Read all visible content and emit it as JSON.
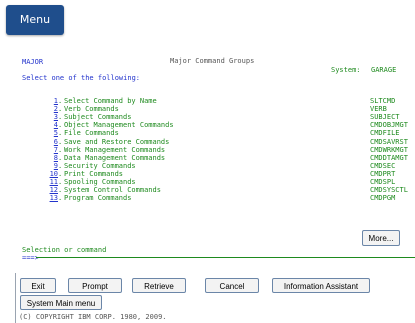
{
  "menu_tab": {
    "label": "Menu"
  },
  "header": {
    "menu_id": "MAJOR",
    "title": "Major Command Groups",
    "system_label": "System:",
    "system_name": "GARAGE"
  },
  "prompt": "Select one of the following:",
  "menu_items": [
    {
      "number": "1",
      "label": "Select Command by Name",
      "command": "SLTCMD"
    },
    {
      "number": "2",
      "label": "Verb Commands",
      "command": "VERB"
    },
    {
      "number": "3",
      "label": "Subject Commands",
      "command": "SUBJECT"
    },
    {
      "number": "4",
      "label": "Object Management Commands",
      "command": "CMDOBJMGT"
    },
    {
      "number": "5",
      "label": "File Commands",
      "command": "CMDFILE"
    },
    {
      "number": "6",
      "label": "Save and Restore Commands",
      "command": "CMDSAVRST"
    },
    {
      "number": "7",
      "label": "Work Management Commands",
      "command": "CMDWRKMGT"
    },
    {
      "number": "8",
      "label": "Data Management Commands",
      "command": "CMDDTAMGT"
    },
    {
      "number": "9",
      "label": "Security Commands",
      "command": "CMDSEC"
    },
    {
      "number": "10",
      "label": "Print Commands",
      "command": "CMDPRT"
    },
    {
      "number": "11",
      "label": "Spooling Commands",
      "command": "CMDSPL"
    },
    {
      "number": "12",
      "label": "System Control Commands",
      "command": "CMDSYSCTL"
    },
    {
      "number": "13",
      "label": "Program Commands",
      "command": "CMDPGM"
    }
  ],
  "more_button": "More...",
  "selection_label": "Selection or command",
  "command_prompt": "===>",
  "function_keys": {
    "exit": "Exit",
    "prompt": "Prompt",
    "retrieve": "Retrieve",
    "cancel": "Cancel",
    "info_assistant": "Information Assistant",
    "system_main_menu": "System Main menu"
  },
  "copyright": "(C) COPYRIGHT IBM CORP. 1980, 2009.",
  "colors": {
    "menu_tab": "#1f4e8c",
    "text_green": "#1e8a1e",
    "text_blue": "#2233cc",
    "button_border": "#6b86a8"
  }
}
